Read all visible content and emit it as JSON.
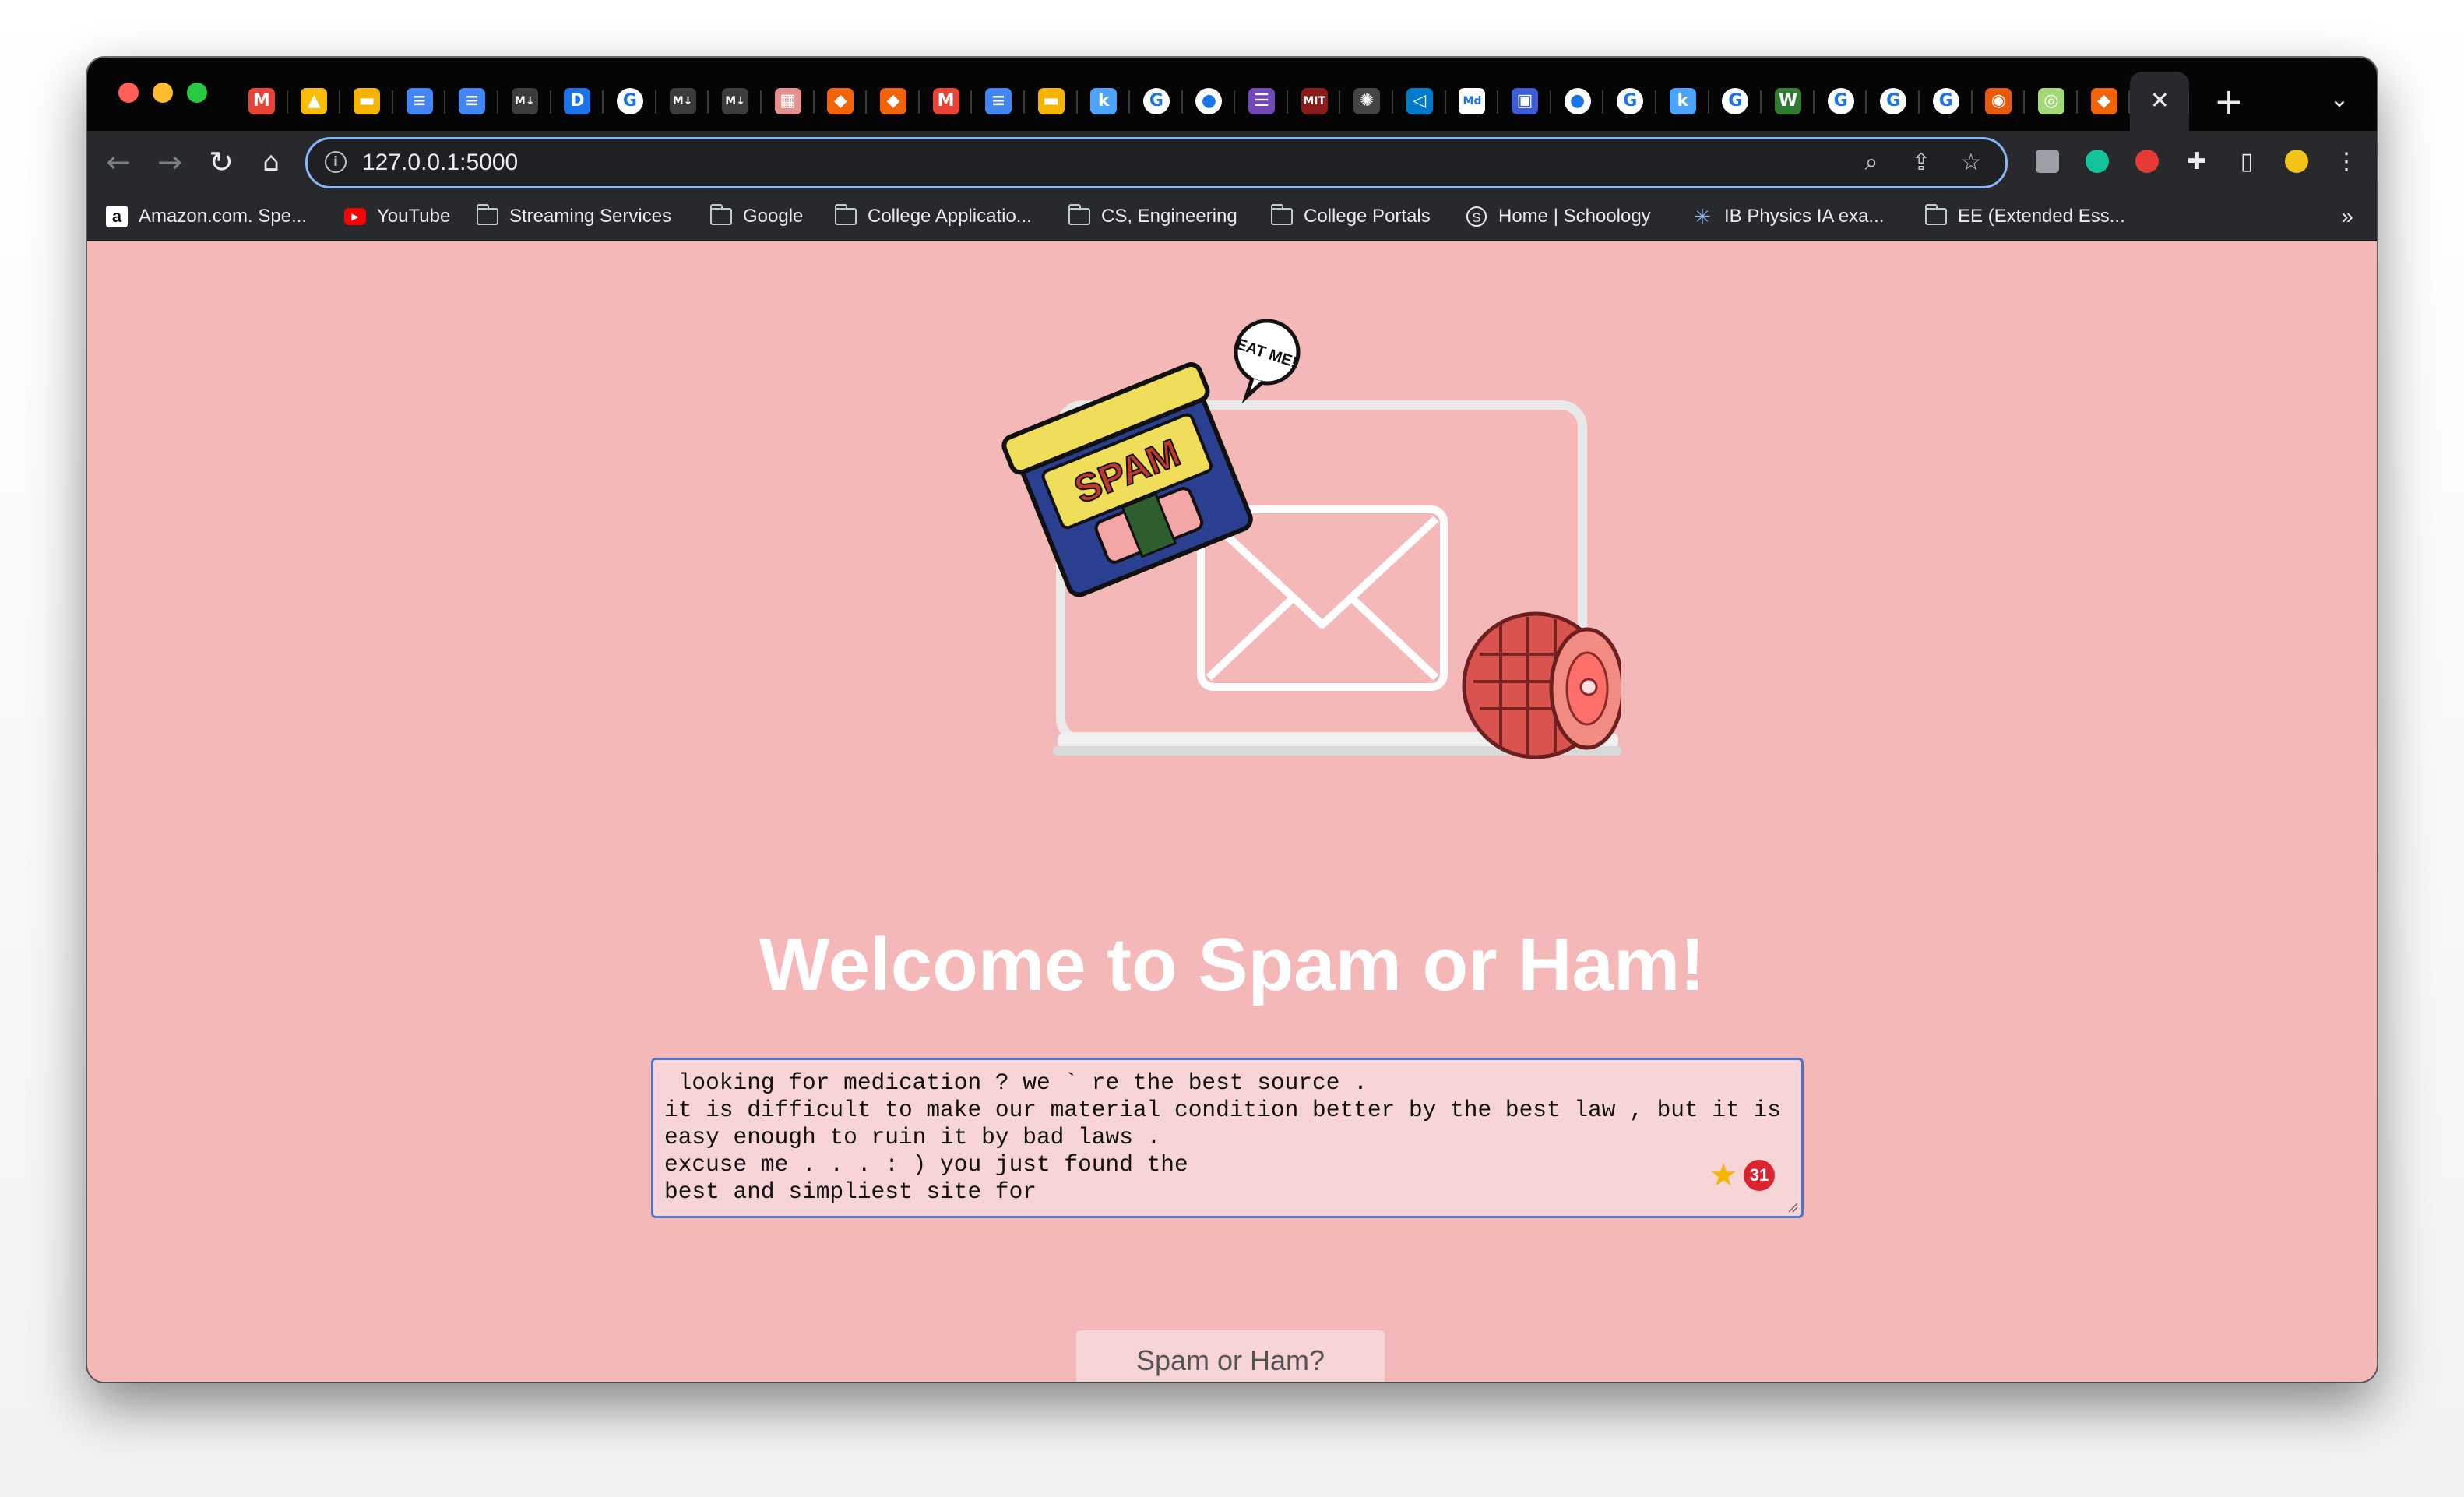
{
  "browser": {
    "tabs": [
      {
        "icon": "gmail-icon",
        "glyph": "M",
        "color": "#ea4335"
      },
      {
        "icon": "google-drive-icon",
        "glyph": "▲",
        "color": "#fbbc04"
      },
      {
        "icon": "google-slides-icon",
        "glyph": "▬",
        "color": "#f4b400"
      },
      {
        "icon": "google-docs-icon",
        "glyph": "≡",
        "color": "#4285f4"
      },
      {
        "icon": "google-docs-icon",
        "glyph": "≡",
        "color": "#4285f4"
      },
      {
        "icon": "markdown-icon",
        "glyph": "M↓",
        "color": "#3c3c3c"
      },
      {
        "icon": "d-app-icon",
        "glyph": "D",
        "color": "#1a73e8"
      },
      {
        "icon": "google-icon",
        "glyph": "G",
        "color": "#ffffff"
      },
      {
        "icon": "markdown-icon",
        "glyph": "M↓",
        "color": "#3c3c3c"
      },
      {
        "icon": "markdown-icon",
        "glyph": "M↓",
        "color": "#3c3c3c"
      },
      {
        "icon": "image-icon",
        "glyph": "▦",
        "color": "#e58f8f"
      },
      {
        "icon": "replit-icon",
        "glyph": "◆",
        "color": "#f26207"
      },
      {
        "icon": "replit-icon",
        "glyph": "◆",
        "color": "#f26207"
      },
      {
        "icon": "gmail-icon",
        "glyph": "M",
        "color": "#ea4335"
      },
      {
        "icon": "google-docs-icon",
        "glyph": "≡",
        "color": "#4285f4"
      },
      {
        "icon": "google-slides-icon",
        "glyph": "▬",
        "color": "#f4b400"
      },
      {
        "icon": "k-app-icon",
        "glyph": "k",
        "color": "#4aa3ff"
      },
      {
        "icon": "google-icon",
        "glyph": "G",
        "color": "#ffffff"
      },
      {
        "icon": "github-icon",
        "glyph": "●",
        "color": "#ffffff"
      },
      {
        "icon": "forms-icon",
        "glyph": "☰",
        "color": "#7248b9"
      },
      {
        "icon": "mit-ocw-icon",
        "glyph": "MIT",
        "color": "#8b1a1a"
      },
      {
        "icon": "openai-icon",
        "glyph": "✺",
        "color": "#444444"
      },
      {
        "icon": "vscode-icon",
        "glyph": "◁",
        "color": "#007acc"
      },
      {
        "icon": "md-icon",
        "glyph": "Md",
        "color": "#ffffff"
      },
      {
        "icon": "stack-icon",
        "glyph": "▣",
        "color": "#3b5bdb"
      },
      {
        "icon": "github-icon",
        "glyph": "●",
        "color": "#ffffff"
      },
      {
        "icon": "google-icon",
        "glyph": "G",
        "color": "#ffffff"
      },
      {
        "icon": "k-app-icon",
        "glyph": "k",
        "color": "#4aa3ff"
      },
      {
        "icon": "google-icon",
        "glyph": "G",
        "color": "#ffffff"
      },
      {
        "icon": "w-app-icon",
        "glyph": "W",
        "color": "#2e7d32"
      },
      {
        "icon": "google-icon",
        "glyph": "G",
        "color": "#ffffff"
      },
      {
        "icon": "google-icon",
        "glyph": "G",
        "color": "#ffffff"
      },
      {
        "icon": "google-icon",
        "glyph": "G",
        "color": "#ffffff"
      },
      {
        "icon": "orange-app-icon",
        "glyph": "◉",
        "color": "#e8590c"
      },
      {
        "icon": "green-app-icon",
        "glyph": "◎",
        "color": "#a3d977"
      },
      {
        "icon": "replit-icon",
        "glyph": "◆",
        "color": "#f26207"
      },
      {
        "icon": "close-icon",
        "glyph": "✕",
        "color": "#e8eaed",
        "active": true
      }
    ],
    "url": "127.0.0.1:5000",
    "bookmarks": [
      {
        "label": "Amazon.com. Spe...",
        "icon": "amazon-icon"
      },
      {
        "label": "YouTube",
        "icon": "youtube-icon"
      },
      {
        "label": "Streaming Services",
        "icon": "folder-icon"
      },
      {
        "label": "Google",
        "icon": "folder-icon"
      },
      {
        "label": "College Applicatio...",
        "icon": "folder-icon"
      },
      {
        "label": "CS, Engineering",
        "icon": "folder-icon"
      },
      {
        "label": "College Portals",
        "icon": "folder-icon"
      },
      {
        "label": "Home | Schoology",
        "icon": "schoology-icon"
      },
      {
        "label": "IB Physics IA exa...",
        "icon": "physics-icon"
      },
      {
        "label": "EE (Extended Ess...",
        "icon": "folder-icon"
      }
    ],
    "bookmarks_overflow": "»"
  },
  "page": {
    "title": "Welcome to Spam or Ham!",
    "message": " looking for medication ? we ` re the best source .\nit is difficult to make our material condition better by the best law , but it is\neasy enough to ruin it by bad laws .\nexcuse me . . . : ) you just found the\nbest and simpliest site for",
    "submit_label": "Spam or Ham?",
    "sticker_text": "EAT ME!",
    "can_label": "SPAM",
    "badge_count": "31"
  },
  "colors": {
    "page_bg": "#f4b8b8",
    "title": "#ffffff",
    "textarea_bg": "#f7d4d6",
    "textarea_border": "#4e75c9"
  }
}
